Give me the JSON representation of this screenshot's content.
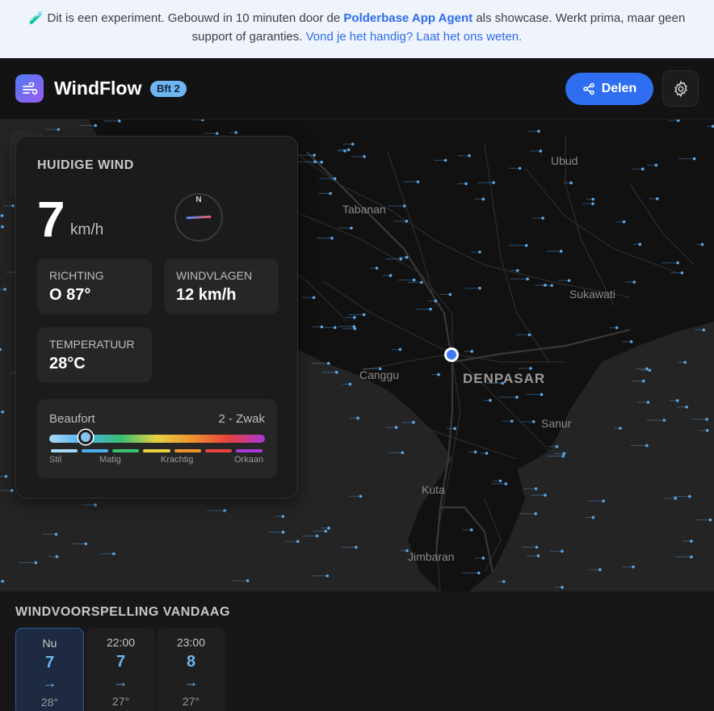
{
  "banner": {
    "icon": "🧪",
    "text1": "Dit is een experiment. Gebouwd in 10 minuten door de ",
    "agent": "Polderbase App Agent",
    "text2": " als showcase. Werkt prima, maar geen support of garanties. ",
    "link": "Vond je het handig? Laat het ons weten."
  },
  "header": {
    "title": "WindFlow",
    "badge": "Bft 2",
    "share_label": "Delen",
    "logo_icon": "wind-icon",
    "share_icon": "share-icon",
    "settings_icon": "gear-icon"
  },
  "map": {
    "labels": [
      "Ubud",
      "Tabanan",
      "Sukawati",
      "Canggu",
      "DENPASAR",
      "Sanur",
      "Kuta",
      "Jimbaran"
    ]
  },
  "current_wind": {
    "title": "HUIDIGE WIND",
    "speed": "7",
    "unit": "km/h",
    "compass_north": "N",
    "direction_degrees": 87,
    "stats": [
      {
        "label": "RICHTING",
        "value": "O 87°"
      },
      {
        "label": "WINDVLAGEN",
        "value": "12 km/h"
      },
      {
        "label": "TEMPERATUUR",
        "value": "28°C"
      }
    ],
    "beaufort": {
      "label": "Beaufort",
      "value": "2 - Zwak",
      "level_fraction": 0.17,
      "ticks": [
        "Stil",
        "Matig",
        "Krachtig",
        "Orkaan"
      ]
    }
  },
  "forecast": {
    "title": "WINDVOORSPELLING VANDAAG",
    "items": [
      {
        "time": "Nu",
        "speed": "7",
        "arrow": "→",
        "temp": "28°"
      },
      {
        "time": "22:00",
        "speed": "7",
        "arrow": "→",
        "temp": "27°"
      },
      {
        "time": "23:00",
        "speed": "8",
        "arrow": "→",
        "temp": "27°"
      }
    ]
  },
  "colors": {
    "accent": "#2f6ef0",
    "wind_blue": "#6cb6f2",
    "beaufort_segments": [
      "#a8d8f8",
      "#4ab0e8",
      "#38c070",
      "#e8d040",
      "#f09030",
      "#e84040",
      "#a838d8"
    ]
  }
}
